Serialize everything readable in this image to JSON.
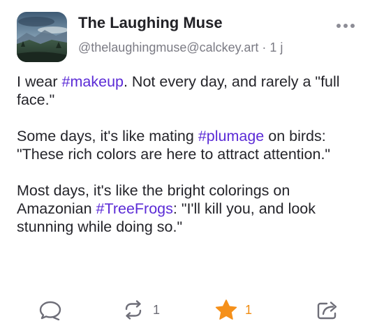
{
  "post": {
    "author": {
      "display_name": "The Laughing Muse",
      "handle": "@thelaughingmuse@calckey.art",
      "separator": "·",
      "time": "1 j",
      "avatar_icon": "misty-landscape-avatar"
    },
    "menu_icon": "more-horizontal-icon",
    "content": {
      "p1_a": "I wear ",
      "p1_tag": "#makeup",
      "p1_b": ". Not every day, and rarely a \"full face.\"",
      "p2_a": "Some days, it's like mating ",
      "p2_tag": "#plumage",
      "p2_b": " on birds: \"These rich colors are here to attract attention.\"",
      "p3_a": "Most days, it's like the bright colorings on Amazonian ",
      "p3_tag": "#TreeFrogs",
      "p3_b": ": \"I'll kill you, and look stunning while doing so.\""
    },
    "actions": {
      "reply_icon": "reply-bubble-icon",
      "boost_icon": "boost-repeat-icon",
      "boost_count": "1",
      "favourite_icon": "star-icon",
      "favourite_count": "1",
      "share_icon": "share-icon"
    },
    "colors": {
      "hashtag": "#5b2bd6",
      "favourite_active": "#f5901a",
      "muted_text": "#7b7b84"
    }
  }
}
